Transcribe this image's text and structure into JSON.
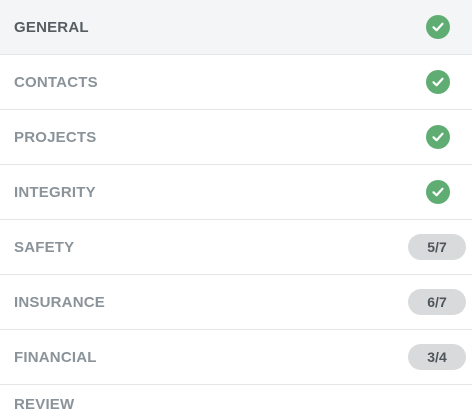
{
  "nav": {
    "items": [
      {
        "label": "GENERAL",
        "status": "complete",
        "active": true
      },
      {
        "label": "CONTACTS",
        "status": "complete"
      },
      {
        "label": "PROJECTS",
        "status": "complete"
      },
      {
        "label": "INTEGRITY",
        "status": "complete"
      },
      {
        "label": "SAFETY",
        "status": "progress",
        "badge": "5/7"
      },
      {
        "label": "INSURANCE",
        "status": "progress",
        "badge": "6/7"
      },
      {
        "label": "FINANCIAL",
        "status": "progress",
        "badge": "3/4"
      },
      {
        "label": "REVIEW",
        "status": "none"
      }
    ]
  },
  "colors": {
    "check": "#5fad73",
    "badge_bg": "#d9dadb",
    "label": "#8a9399",
    "label_active": "#555d63"
  },
  "icons": {
    "complete": "check-circle-icon"
  }
}
